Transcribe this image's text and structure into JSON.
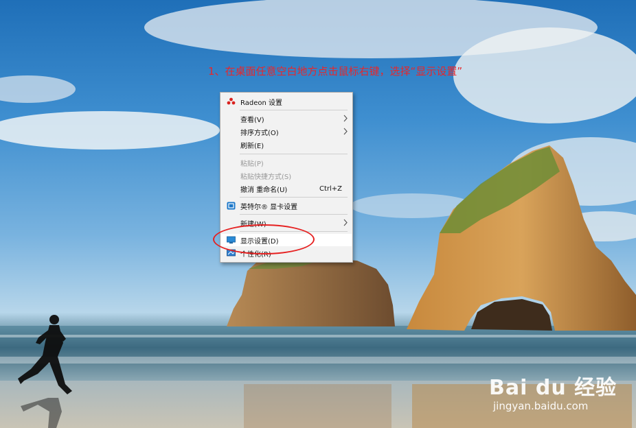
{
  "instruction": "1、在桌面任意空白地方点击鼠标右键，选择“显示设置”",
  "context_menu": {
    "items": [
      {
        "label": "Radeon 设置",
        "icon": "radeon-icon"
      },
      {
        "label": "查看(V)",
        "submenu": true
      },
      {
        "label": "排序方式(O)",
        "submenu": true
      },
      {
        "label": "刷新(E)"
      },
      {
        "label": "粘贴(P)",
        "disabled": true
      },
      {
        "label": "粘贴快捷方式(S)",
        "disabled": true
      },
      {
        "label": "撤消 重命名(U)",
        "shortcut": "Ctrl+Z"
      },
      {
        "label": "英特尔® 显卡设置",
        "icon": "intel-graphics-icon"
      },
      {
        "label": "新建(W)",
        "submenu": true
      },
      {
        "label": "显示设置(D)",
        "icon": "display-settings-icon",
        "highlighted": true
      },
      {
        "label": "个性化(R)",
        "icon": "personalize-icon"
      }
    ]
  },
  "watermark": {
    "logo": "Bai du 经验",
    "url": "jingyan.baidu.com"
  },
  "colors": {
    "annotation": "#e62020",
    "menu_bg": "#f2f2f2"
  }
}
